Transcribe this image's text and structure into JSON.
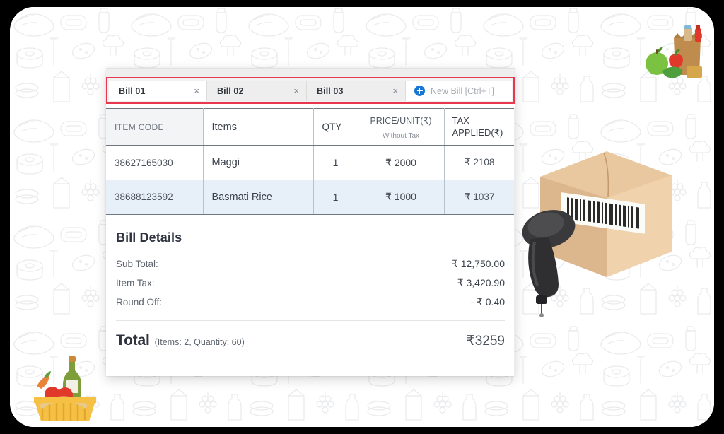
{
  "app": {
    "background_pattern": "grocery-doodles",
    "accent_red": "#e8384f",
    "accent_blue": "#1976d2",
    "row_highlight": "#e7f0f9"
  },
  "tabs": {
    "items": [
      {
        "label": "Bill 01",
        "active": true,
        "close_icon": "×"
      },
      {
        "label": "Bill 02",
        "active": false,
        "close_icon": "×"
      },
      {
        "label": "Bill 03",
        "active": false,
        "close_icon": "×"
      }
    ],
    "new_bill": {
      "label": "New Bill [Ctrl+T]",
      "icon": "plus-circle-icon"
    }
  },
  "table": {
    "headers": {
      "item_code": "ITEM CODE",
      "items": "Items",
      "qty": "QTY",
      "price_unit": "PRICE/UNIT(₹)",
      "price_unit_sub": "Without Tax",
      "tax_applied": "TAX APPLIED(₹)"
    },
    "rows": [
      {
        "item_code": "38627165030",
        "item_name": "Maggi",
        "qty": "1",
        "price": "₹ 2000",
        "tax": "₹ 2108",
        "highlighted": false
      },
      {
        "item_code": "38688123592",
        "item_name": "Basmati Rice",
        "qty": "1",
        "price": "₹ 1000",
        "tax": "₹ 1037",
        "highlighted": true
      }
    ]
  },
  "bill_details": {
    "title": "Bill Details",
    "lines": [
      {
        "label": "Sub Total:",
        "value": "₹ 12,750.00"
      },
      {
        "label": "Item Tax:",
        "value": "₹ 3,420.90"
      },
      {
        "label": "Round Off:",
        "value": "- ₹ 0.40"
      }
    ],
    "total": {
      "word": "Total",
      "meta": "(Items: 2, Quantity: 60)",
      "value": "₹3259"
    }
  },
  "illustrations": {
    "grocery_bag": "grocery-bag-illustration",
    "picnic_basket": "picnic-basket-illustration",
    "barcode_scanner": "barcode-scanner-box-illustration"
  }
}
